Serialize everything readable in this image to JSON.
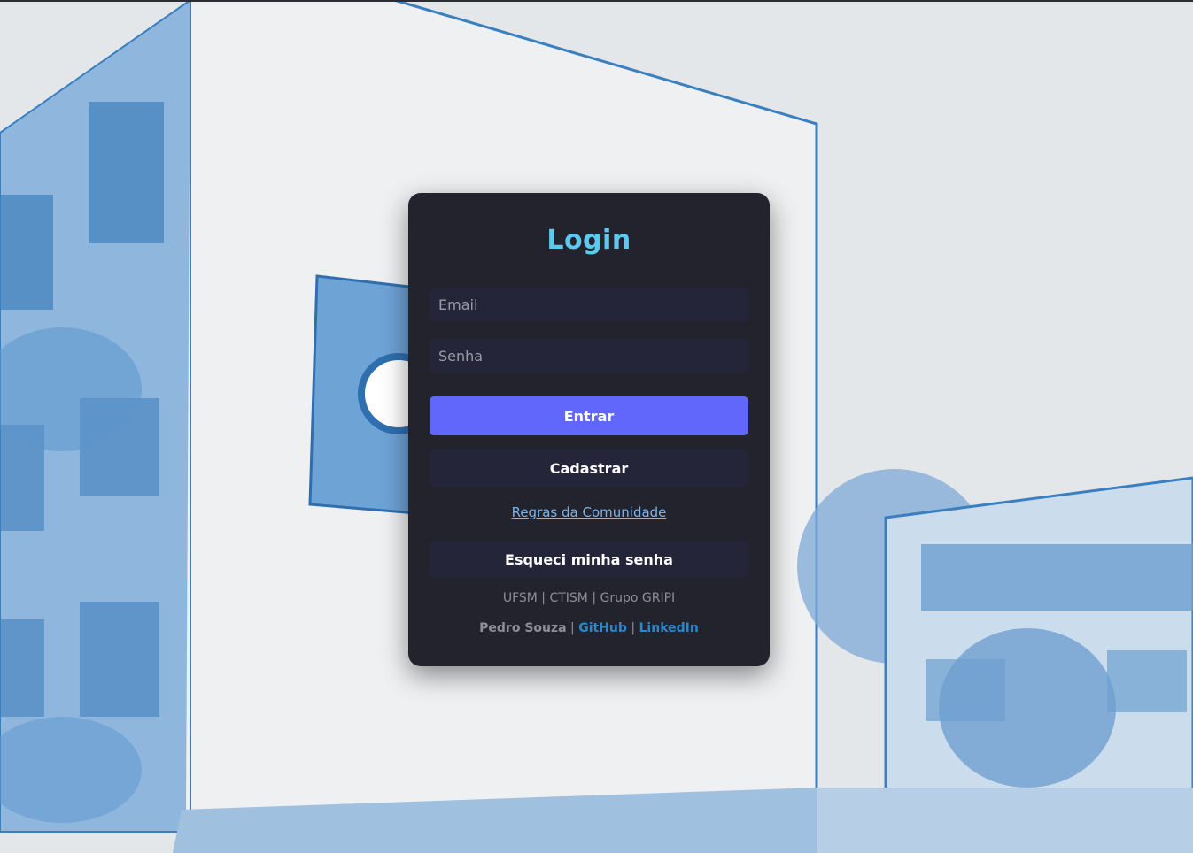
{
  "login": {
    "title": "Login",
    "email_placeholder": "Email",
    "password_placeholder": "Senha",
    "submit_label": "Entrar",
    "register_label": "Cadastrar",
    "rules_link": "Regras da Comunidade",
    "forgot_label": "Esqueci minha senha"
  },
  "footer": {
    "org_line": "UFSM | CTISM | Grupo GRIPI",
    "author": "Pedro Souza",
    "separator": "|",
    "github_label": "GitHub",
    "linkedin_label": "LinkedIn"
  },
  "colors": {
    "card_bg": "#22232d",
    "title": "#5fc8ef",
    "primary_button": "#6167fb",
    "secondary_button": "#25253a",
    "link": "#78b4ee",
    "social_link": "#2c87c9"
  }
}
